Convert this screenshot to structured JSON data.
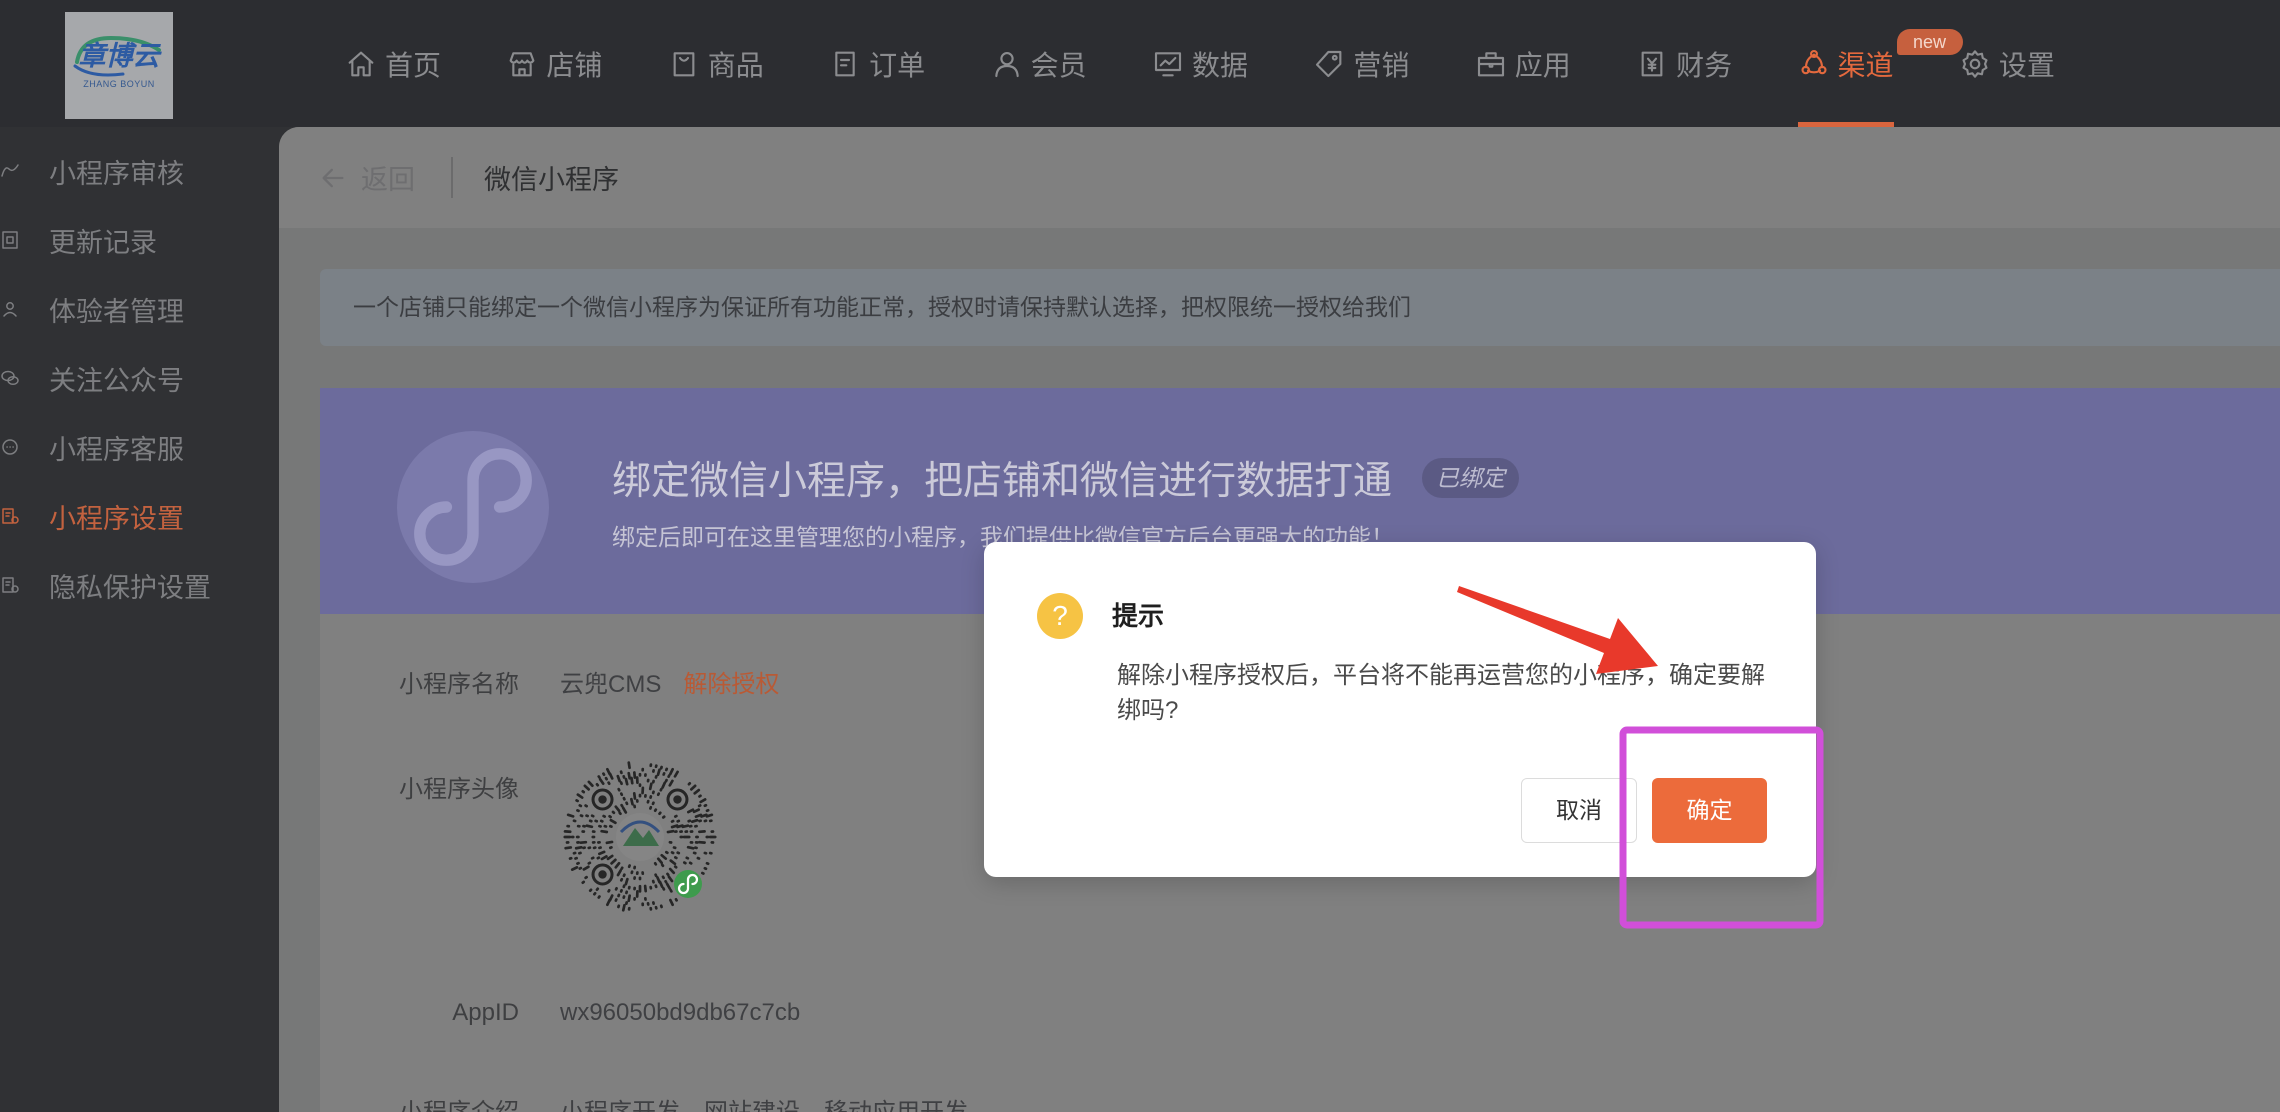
{
  "theme": {
    "accent": "#ec6b3b",
    "nav_active": "#e3693e",
    "warning_icon": "#f6c344",
    "annotation_arrow": "#e8392b",
    "annotation_box": "#d14fd9"
  },
  "logo": {
    "name": "章博云",
    "subtitle": "ZHANG BOYUN"
  },
  "nav": {
    "items": [
      {
        "label": "首页",
        "icon": "home-icon"
      },
      {
        "label": "店铺",
        "icon": "shop-icon"
      },
      {
        "label": "商品",
        "icon": "goods-icon"
      },
      {
        "label": "订单",
        "icon": "order-icon"
      },
      {
        "label": "会员",
        "icon": "member-icon"
      },
      {
        "label": "数据",
        "icon": "data-chart-icon"
      },
      {
        "label": "营销",
        "icon": "tag-icon"
      },
      {
        "label": "应用",
        "icon": "briefcase-icon"
      },
      {
        "label": "财务",
        "icon": "yen-document-icon"
      },
      {
        "label": "渠道",
        "icon": "channel-icon",
        "active": true,
        "badge": "new"
      },
      {
        "label": "设置",
        "icon": "gear-icon"
      }
    ]
  },
  "sidebar": {
    "items": [
      {
        "label": "小程序审核",
        "icon": "review-icon"
      },
      {
        "label": "更新记录",
        "icon": "record-icon"
      },
      {
        "label": "体验者管理",
        "icon": "user-icon"
      },
      {
        "label": "关注公众号",
        "icon": "wechat-icon"
      },
      {
        "label": "小程序客服",
        "icon": "chat-icon"
      },
      {
        "label": "小程序设置",
        "icon": "settings-document-icon",
        "active": true
      },
      {
        "label": "隐私保护设置",
        "icon": "privacy-document-icon"
      }
    ]
  },
  "header": {
    "back_label": "返回",
    "title": "微信小程序"
  },
  "notice": {
    "text": "一个店铺只能绑定一个微信小程序为保证所有功能正常，授权时请保持默认选择，把权限统一授权给我们"
  },
  "banner": {
    "title": "绑定微信小程序，把店铺和微信进行数据打通",
    "status_badge": "已绑定",
    "subtitle": "绑定后即可在这里管理您的小程序，我们提供比微信官方后台更强大的功能！"
  },
  "details": {
    "name_label": "小程序名称",
    "name_value": "云兜CMS",
    "unbind_link": "解除授权",
    "avatar_label": "小程序头像",
    "appid_label": "AppID",
    "appid_value": "wx96050bd9db67c7cb",
    "intro_label": "小程序介绍",
    "intro_value": "小程序开发，网站建设，移动应用开发"
  },
  "dialog": {
    "icon": "question-icon",
    "title": "提示",
    "message": "解除小程序授权后，平台将不能再运营您的小程序，确定要解绑吗?",
    "cancel_label": "取消",
    "confirm_label": "确定"
  }
}
